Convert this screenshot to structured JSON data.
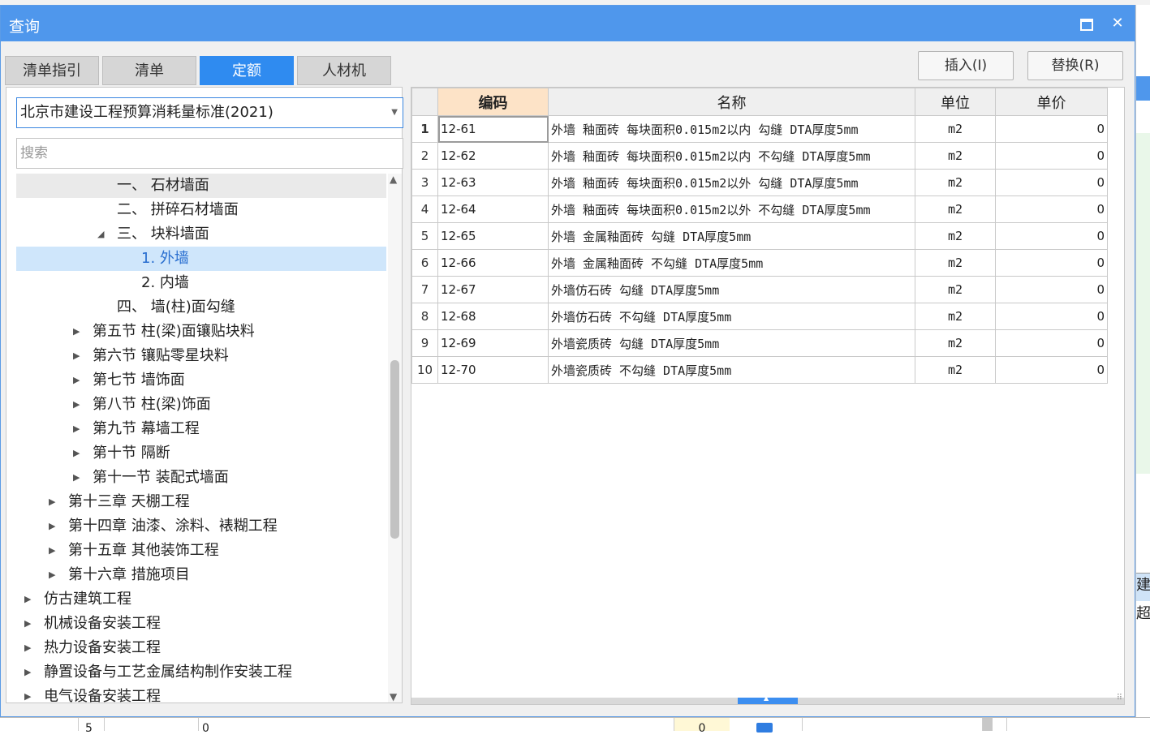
{
  "dialog": {
    "title": "查询",
    "maximize_symbol": "□",
    "close_symbol": "✕"
  },
  "tabs": [
    {
      "label": "清单指引",
      "active": false
    },
    {
      "label": "清单",
      "active": false
    },
    {
      "label": "定额",
      "active": true
    },
    {
      "label": "人材机",
      "active": false
    }
  ],
  "actions": {
    "insert": "插入(I)",
    "replace": "替换(R)"
  },
  "standard_select": {
    "value": "北京市建设工程预算消耗量标准(2021)"
  },
  "search": {
    "placeholder": "搜索"
  },
  "tree": [
    {
      "label": "一、 石材墙面",
      "expander": "",
      "style": "dim"
    },
    {
      "label": "二、 拼碎石材墙面",
      "expander": "",
      "style": ""
    },
    {
      "label": "三、 块料墙面",
      "expander": "◢",
      "style": ""
    },
    {
      "label": "1. 外墙",
      "expander": "",
      "style": "sel"
    },
    {
      "label": "2. 内墙",
      "expander": "",
      "style": ""
    },
    {
      "label": "四、 墙(柱)面勾缝",
      "expander": "",
      "style": ""
    },
    {
      "label": "第五节 柱(梁)面镶贴块料",
      "expander": "▶",
      "style": ""
    },
    {
      "label": "第六节 镶贴零星块料",
      "expander": "▶",
      "style": ""
    },
    {
      "label": "第七节 墙饰面",
      "expander": "▶",
      "style": ""
    },
    {
      "label": "第八节 柱(梁)饰面",
      "expander": "▶",
      "style": ""
    },
    {
      "label": "第九节 幕墙工程",
      "expander": "▶",
      "style": ""
    },
    {
      "label": "第十节 隔断",
      "expander": "▶",
      "style": ""
    },
    {
      "label": "第十一节 装配式墙面",
      "expander": "▶",
      "style": ""
    },
    {
      "label": "第十三章 天棚工程",
      "expander": "▶",
      "style": ""
    },
    {
      "label": "第十四章 油漆、涂料、裱糊工程",
      "expander": "▶",
      "style": ""
    },
    {
      "label": "第十五章 其他装饰工程",
      "expander": "▶",
      "style": ""
    },
    {
      "label": "第十六章 措施项目",
      "expander": "▶",
      "style": ""
    },
    {
      "label": "仿古建筑工程",
      "expander": "▶",
      "style": ""
    },
    {
      "label": "机械设备安装工程",
      "expander": "▶",
      "style": ""
    },
    {
      "label": "热力设备安装工程",
      "expander": "▶",
      "style": ""
    },
    {
      "label": "静置设备与工艺金属结构制作安装工程",
      "expander": "▶",
      "style": ""
    },
    {
      "label": "电气设备安装工程",
      "expander": "▶",
      "style": ""
    }
  ],
  "grid": {
    "headers": {
      "code": "编码",
      "name": "名称",
      "unit": "单位",
      "price": "单价"
    },
    "rows": [
      {
        "no": "1",
        "code": "12-61",
        "name": "外墙 釉面砖 每块面积0.015m2以内 勾缝 DTA厚度5mm",
        "unit": "m2",
        "price": "0"
      },
      {
        "no": "2",
        "code": "12-62",
        "name": "外墙 釉面砖 每块面积0.015m2以内 不勾缝 DTA厚度5mm",
        "unit": "m2",
        "price": "0"
      },
      {
        "no": "3",
        "code": "12-63",
        "name": "外墙 釉面砖 每块面积0.015m2以外 勾缝 DTA厚度5mm",
        "unit": "m2",
        "price": "0"
      },
      {
        "no": "4",
        "code": "12-64",
        "name": "外墙 釉面砖 每块面积0.015m2以外 不勾缝 DTA厚度5mm",
        "unit": "m2",
        "price": "0"
      },
      {
        "no": "5",
        "code": "12-65",
        "name": "外墙 金属釉面砖 勾缝 DTA厚度5mm",
        "unit": "m2",
        "price": "0"
      },
      {
        "no": "6",
        "code": "12-66",
        "name": "外墙 金属釉面砖 不勾缝 DTA厚度5mm",
        "unit": "m2",
        "price": "0"
      },
      {
        "no": "7",
        "code": "12-67",
        "name": "外墙仿石砖 勾缝 DTA厚度5mm",
        "unit": "m2",
        "price": "0"
      },
      {
        "no": "8",
        "code": "12-68",
        "name": "外墙仿石砖 不勾缝 DTA厚度5mm",
        "unit": "m2",
        "price": "0"
      },
      {
        "no": "9",
        "code": "12-69",
        "name": "外墙瓷质砖 勾缝 DTA厚度5mm",
        "unit": "m2",
        "price": "0"
      },
      {
        "no": "10",
        "code": "12-70",
        "name": "外墙瓷质砖 不勾缝 DTA厚度5mm",
        "unit": "m2",
        "price": "0"
      }
    ]
  },
  "background": {
    "right_cell_a": "建",
    "right_cell_b": "超",
    "bottom_cells": [
      "5",
      "0",
      "0"
    ]
  },
  "colors": {
    "titlebar": "#4f97ec",
    "active_tab": "#2f8bf0",
    "selected_node": "#cfe6fb",
    "code_header": "#fde3c7"
  }
}
